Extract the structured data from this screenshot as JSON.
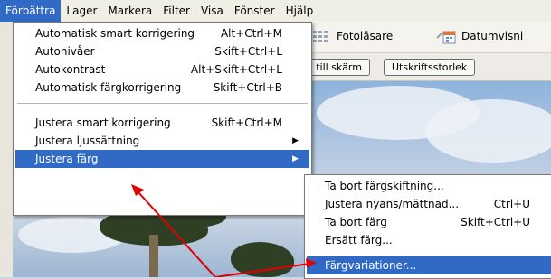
{
  "menubar": {
    "items": [
      "Förbättra",
      "Lager",
      "Markera",
      "Filter",
      "Visa",
      "Fönster",
      "Hjälp"
    ]
  },
  "toolbar": {
    "viewer_label": "Fotoläsare",
    "date_label": "Datumvisni"
  },
  "options": {
    "fit_label": "a till skärm",
    "print_size_label": "Utskriftsstorlek"
  },
  "menu": {
    "items": [
      {
        "label": "Automatisk smart korrigering",
        "shortcut": "Alt+Ctrl+M"
      },
      {
        "label": "Autonivåer",
        "shortcut": "Skift+Ctrl+L"
      },
      {
        "label": "Autokontrast",
        "shortcut": "Alt+Skift+Ctrl+L"
      },
      {
        "label": "Automatisk färgkorrigering",
        "shortcut": "Skift+Ctrl+B"
      },
      {
        "label": "Justera smart korrigering",
        "shortcut": "Skift+Ctrl+M"
      },
      {
        "label": "Justera ljussättning",
        "shortcut": ""
      },
      {
        "label": "Justera färg",
        "shortcut": ""
      }
    ]
  },
  "submenu": {
    "items": [
      {
        "label": "Ta bort färgskiftning...",
        "shortcut": ""
      },
      {
        "label": "Justera nyans/mättnad...",
        "shortcut": "Ctrl+U"
      },
      {
        "label": "Ta bort färg",
        "shortcut": "Skift+Ctrl+U"
      },
      {
        "label": "Ersätt färg...",
        "shortcut": ""
      },
      {
        "label": "Färgvariationer...",
        "shortcut": ""
      }
    ]
  },
  "colors": {
    "highlight": "#316ac5",
    "arrow": "#e00000"
  }
}
